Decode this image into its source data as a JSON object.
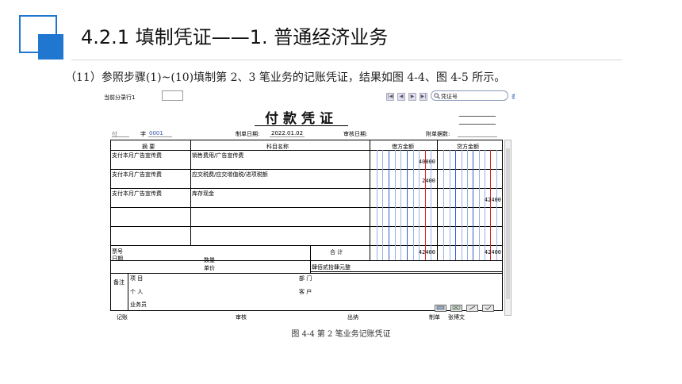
{
  "slide": {
    "title": "4.2.1  填制凭证——1. 普通经济业务",
    "step_text": "（11）参照步骤(1)~(10)填制第 2、3 笔业务的记账凭证，结果如图 4-4、图 4-5 所示。",
    "caption": "图 4-4  第 2 笔业务记账凭证",
    "accent_color": "#1f77d0"
  },
  "toolbar": {
    "current_row_label": "当前分录行1",
    "nav_buttons": [
      "first",
      "prev",
      "next",
      "last"
    ],
    "search_placeholder": "凭证号",
    "search_icon": "search-icon",
    "query_label": "查询"
  },
  "voucher": {
    "title": "付款凭证",
    "type_label": "付",
    "number_prefix": "字",
    "number": "0001",
    "make_date_label": "制单日期:",
    "make_date": "2022.01.02",
    "audit_date_label": "审核日期:",
    "attachments_label": "附单据数:",
    "headers": {
      "summary": "摘 要",
      "account": "科目名称",
      "debit": "借方金额",
      "credit": "贷方金额"
    },
    "rows": [
      {
        "summary": "支付本月广告宣传费",
        "account": "销售费用/广告宣传费",
        "debit": "40000",
        "credit": ""
      },
      {
        "summary": "支付本月广告宣传费",
        "account": "应交税费/应交增值税/进项税额",
        "debit": "2400",
        "credit": ""
      },
      {
        "summary": "支付本月广告宣传费",
        "account": "库存现金",
        "debit": "",
        "credit": "42400"
      },
      {
        "summary": "",
        "account": "",
        "debit": "",
        "credit": ""
      },
      {
        "summary": "",
        "account": "",
        "debit": "",
        "credit": ""
      }
    ],
    "ticket_no_label": "票号",
    "date_label": "日期",
    "quantity_label": "数量",
    "unit_price_label": "单价",
    "total_label": "合 计",
    "total_debit": "42400",
    "total_credit": "42400",
    "amount_in_words": "肆佰贰拾肆元整",
    "remarks": {
      "label": "备注",
      "project": "项  目",
      "department": "部  门",
      "individual": "个  人",
      "customer": "客  户",
      "salesperson": "业务员"
    },
    "footer": {
      "bookkeeper": "记账",
      "reviewer": "审核",
      "cashier": "出纳",
      "maker_label": "制单",
      "maker": "张博文"
    },
    "tool_icons": [
      "note-icon",
      "image-icon",
      "pen-icon",
      "check-icon"
    ]
  }
}
